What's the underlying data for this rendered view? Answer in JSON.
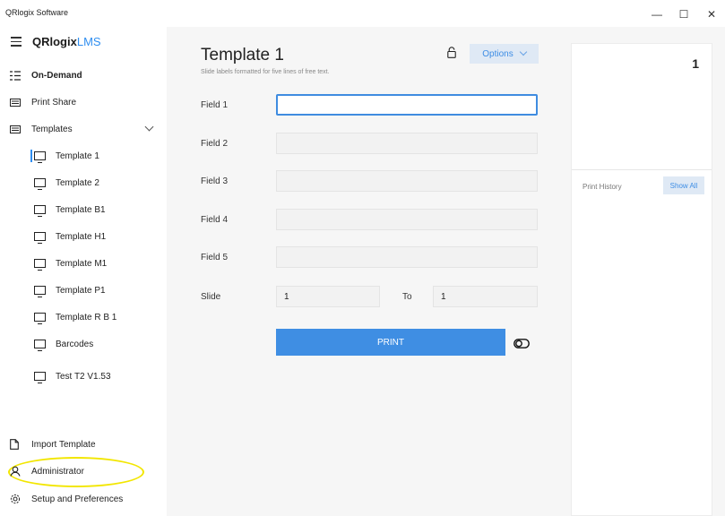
{
  "window": {
    "title": "QRlogix Software",
    "minimize": "—",
    "maximize": "☐",
    "close": "✕"
  },
  "sidebar": {
    "brand_bold": "QRlogix",
    "brand_light": "LMS",
    "nav": {
      "on_demand": "On-Demand",
      "print_share": "Print Share",
      "templates": "Templates"
    },
    "templates": [
      {
        "label": "Template 1"
      },
      {
        "label": "Template 2"
      },
      {
        "label": "Template B1"
      },
      {
        "label": "Template H1"
      },
      {
        "label": "Template M1"
      },
      {
        "label": "Template P1"
      },
      {
        "label": "Template R B 1"
      },
      {
        "label": "Barcodes"
      },
      {
        "label": "Test T2 V1.53"
      }
    ],
    "bottom": {
      "import": "Import Template",
      "admin": "Administrator",
      "setup": "Setup and Preferences"
    }
  },
  "main": {
    "title": "Template 1",
    "subtitle": "Slide labels formatted for five lines of free text.",
    "options_label": "Options",
    "fields": [
      {
        "label": "Field 1",
        "value": ""
      },
      {
        "label": "Field 2",
        "value": ""
      },
      {
        "label": "Field 3",
        "value": ""
      },
      {
        "label": "Field 4",
        "value": ""
      },
      {
        "label": "Field 5",
        "value": ""
      }
    ],
    "slide_label": "Slide",
    "slide_from": "1",
    "to_label": "To",
    "slide_to": "1",
    "print_label": "PRINT"
  },
  "right_panel": {
    "count": "1",
    "print_history_label": "Print History",
    "show_all_label": "Show All"
  },
  "colors": {
    "accent": "#3f8ee3",
    "highlight": "#f2e600"
  }
}
